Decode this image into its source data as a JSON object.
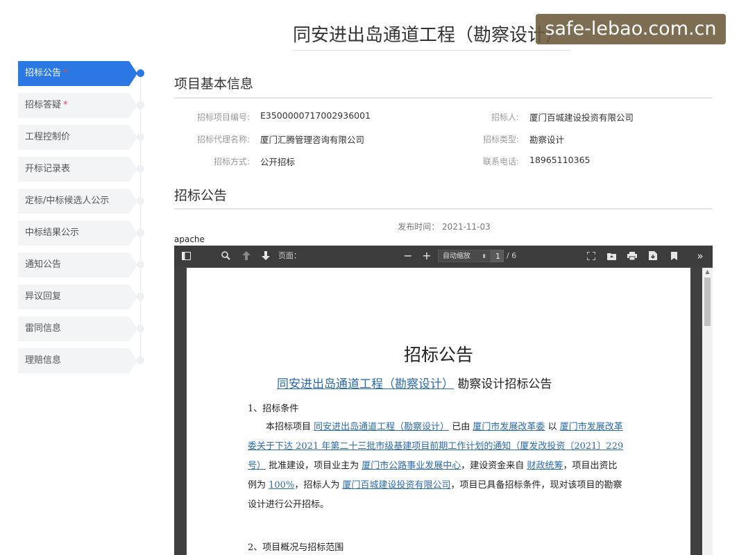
{
  "header": {
    "title": "同安进出岛通道工程（勘察设计）",
    "watermark": "safe-lebao.com.cn"
  },
  "sidebar": {
    "items": [
      {
        "label": "招标公告",
        "required": true,
        "active": true
      },
      {
        "label": "招标答疑",
        "required": true,
        "active": false
      },
      {
        "label": "工程控制价",
        "required": false,
        "active": false
      },
      {
        "label": "开标记录表",
        "required": false,
        "active": false
      },
      {
        "label": "定标/中标候选人公示",
        "required": false,
        "active": false
      },
      {
        "label": "中标结果公示",
        "required": false,
        "active": false
      },
      {
        "label": "通知公告",
        "required": false,
        "active": false
      },
      {
        "label": "异议回复",
        "required": false,
        "active": false
      },
      {
        "label": "雷同信息",
        "required": false,
        "active": false
      },
      {
        "label": "理赔信息",
        "required": false,
        "active": false
      }
    ],
    "required_mark": "*"
  },
  "basic_info": {
    "section_title": "项目基本信息",
    "fields": [
      {
        "label": "招标项目编号:",
        "value": "E3500000717002936001"
      },
      {
        "label": "招标人:",
        "value": "厦门百城建设投资有限公司"
      },
      {
        "label": "招标代理名称:",
        "value": "厦门汇腾管理咨询有限公司"
      },
      {
        "label": "招标类型:",
        "value": "勘察设计"
      },
      {
        "label": "招标方式:",
        "value": "公开招标"
      },
      {
        "label": "联系电话:",
        "value": "18965110365"
      }
    ]
  },
  "notice": {
    "section_title": "招标公告",
    "publish_label": "发布时间：",
    "publish_date": "2021-11-03"
  },
  "pdf_viewer": {
    "frame_label": "apache",
    "page_label": "页面：",
    "current_page": "1",
    "total_pages": "/ 6",
    "zoom_value": "自动缩放",
    "icons": [
      "sidebar-toggle-icon",
      "search-icon",
      "prev-page-icon",
      "next-page-icon",
      "zoom-out-icon",
      "zoom-in-icon",
      "fullscreen-icon",
      "open-file-icon",
      "print-icon",
      "download-icon",
      "bookmark-icon",
      "more-tools-icon"
    ]
  },
  "document": {
    "title": "招标公告",
    "subtitle_link": "同安进出岛通道工程（勘察设计）",
    "subtitle_rest": " 勘察设计招标公告",
    "h1": "1、招标条件",
    "p1": [
      {
        "t": "　　本招标项目 ",
        "u": false
      },
      {
        "t": "同安进出岛通道工程（勘察设计）",
        "u": true
      },
      {
        "t": " 已由 ",
        "u": false
      },
      {
        "t": "厦门市发展改革委",
        "u": true
      },
      {
        "t": " 以 ",
        "u": false
      },
      {
        "t": "厦门市发展改革委关于下达 2021 年第二十三批市级基建项目前期工作计划的通知（厦发改投资〔2021〕229 号）",
        "u": true
      },
      {
        "t": " 批准建设，项目业主为 ",
        "u": false
      },
      {
        "t": "厦门市公路事业发展中心",
        "u": true
      },
      {
        "t": "，建设资金来自 ",
        "u": false
      },
      {
        "t": "财政统筹",
        "u": true
      },
      {
        "t": "，项目出资比例为 ",
        "u": false
      },
      {
        "t": "100%",
        "u": true
      },
      {
        "t": "，招标人为 ",
        "u": false
      },
      {
        "t": "厦门百城建设投资有限公司",
        "u": true
      },
      {
        "t": "，项目已具备招标条件，现对该项目的勘察设计进行公开招标。",
        "u": false
      }
    ],
    "h2": "2、项目概况与招标范围"
  }
}
